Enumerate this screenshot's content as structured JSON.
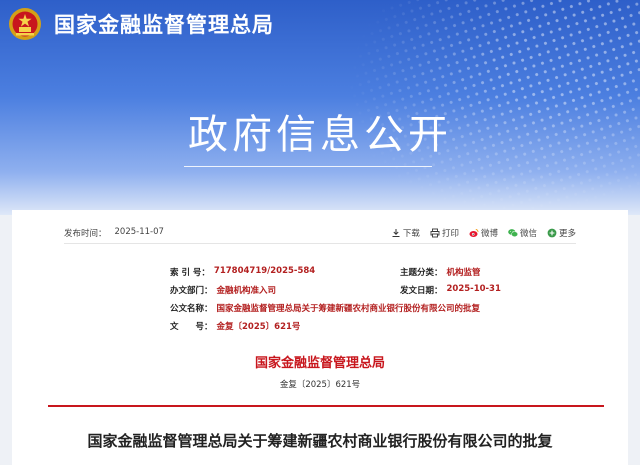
{
  "header": {
    "brand_name": "国家金融监督管理总局",
    "hero_title": "政府信息公开"
  },
  "meta_bar": {
    "publish_label": "发布时间：",
    "publish_date": "2025-11-07",
    "actions": [
      {
        "label": "下载",
        "icon": "download-icon"
      },
      {
        "label": "打印",
        "icon": "print-icon"
      },
      {
        "label": "微博",
        "icon": "weibo-icon"
      },
      {
        "label": "微信",
        "icon": "wechat-icon"
      },
      {
        "label": "更多",
        "icon": "plus-icon"
      }
    ]
  },
  "info": {
    "index_label": "索 引 号：",
    "index_value": "717804719/2025-584",
    "topic_label": "主题分类：",
    "topic_value": "机构监管",
    "office_label": "办文部门：",
    "office_value": "金融机构准入司",
    "date_label": "发文日期：",
    "date_value": "2025-10-31",
    "name_label": "公文名称：",
    "name_value": "国家金融监督管理总局关于筹建新疆农村商业银行股份有限公司的批复",
    "docno_label": "文　　号：",
    "docno_value": "金复〔2025〕621号"
  },
  "document": {
    "issuer": "国家金融监督管理总局",
    "doc_number": "金复〔2025〕621号",
    "title": "国家金融监督管理总局关于筹建新疆农村商业银行股份有限公司的批复"
  },
  "colors": {
    "banner_blue": "#2e5fc9",
    "accent_red": "#c8161d"
  }
}
